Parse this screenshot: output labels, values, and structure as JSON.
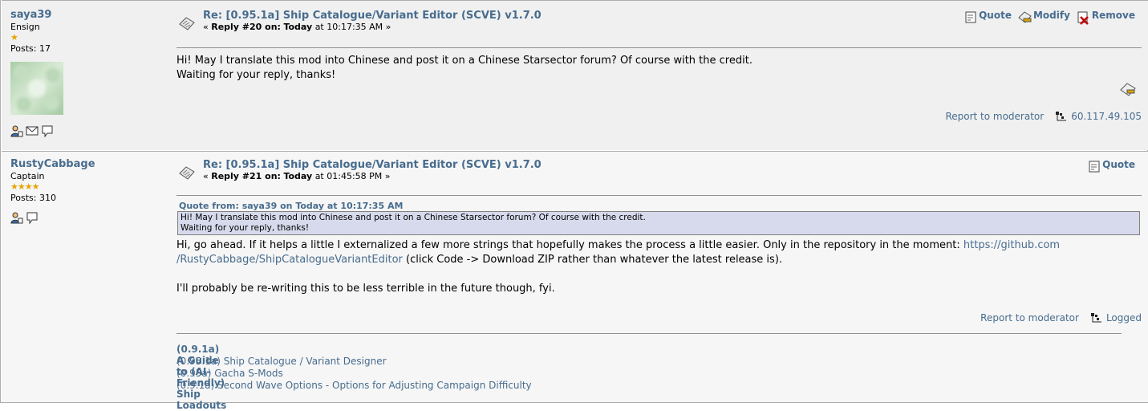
{
  "posts": [
    {
      "poster": {
        "name": "saya39",
        "rank": "Ensign",
        "stars": "★",
        "posts": "Posts: 17"
      },
      "subject": "Re: [0.95.1a] Ship Catalogue/Variant Editor (SCVE) v1.7.0",
      "reply_prefix": "« ",
      "reply_number": "Reply #20 on:",
      "reply_day": "Today",
      "reply_time": "at 10:17:35 AM »",
      "buttons": {
        "quote": "Quote",
        "modify": "Modify",
        "remove": "Remove"
      },
      "body_lines": [
        "Hi! May I translate this mod into Chinese and post it on a Chinese Starsector forum? Of course with the credit.",
        "Waiting for your reply, thanks!"
      ],
      "report": "Report to moderator",
      "ip": "60.117.49.105"
    },
    {
      "poster": {
        "name": "RustyCabbage",
        "rank": "Captain",
        "stars": "★★★★",
        "posts": "Posts: 310"
      },
      "subject": "Re: [0.95.1a] Ship Catalogue/Variant Editor (SCVE) v1.7.0",
      "reply_prefix": "« ",
      "reply_number": "Reply #21 on:",
      "reply_day": "Today",
      "reply_time": "at 01:45:58 PM »",
      "buttons": {
        "quote": "Quote"
      },
      "quote": {
        "header": "Quote from: saya39 on Today at 10:17:35 AM",
        "lines": [
          "Hi! May I translate this mod into Chinese and post it on a Chinese Starsector forum? Of course with the credit.",
          "Waiting for your reply, thanks!"
        ]
      },
      "body": {
        "line1_pre": "Hi, go ahead. If it helps a little I externalized a few more strings that hopefully makes the process a little easier. Only in the repository in the moment: ",
        "link_part1": "https://github.com",
        "link_part2": "/RustyCabbage/ShipCatalogueVariantEditor",
        "line2_post": " (click Code -> Download ZIP rather than whatever the latest release is).",
        "line3": "I'll probably be re-writing this to be less terrible in the future though, fyi."
      },
      "report": "Report to moderator",
      "logged": "Logged",
      "signature": {
        "title": "(0.9.1a) A Guide to (AI-Friendly) Ship Loadouts",
        "links": [
          "(0.95.1a) Ship Catalogue / Variant Designer",
          "(0.95a) Gacha S-Mods",
          "(0.9.1a) Second Wave Options - Options for Adjusting Campaign Difficulty"
        ]
      }
    }
  ],
  "colors": {
    "link": "#476c8e",
    "post_bg_1": "#f0f0f0",
    "post_bg_2": "#f6f6f6",
    "quote_bg": "#d7daec",
    "star": "#e8a400"
  }
}
